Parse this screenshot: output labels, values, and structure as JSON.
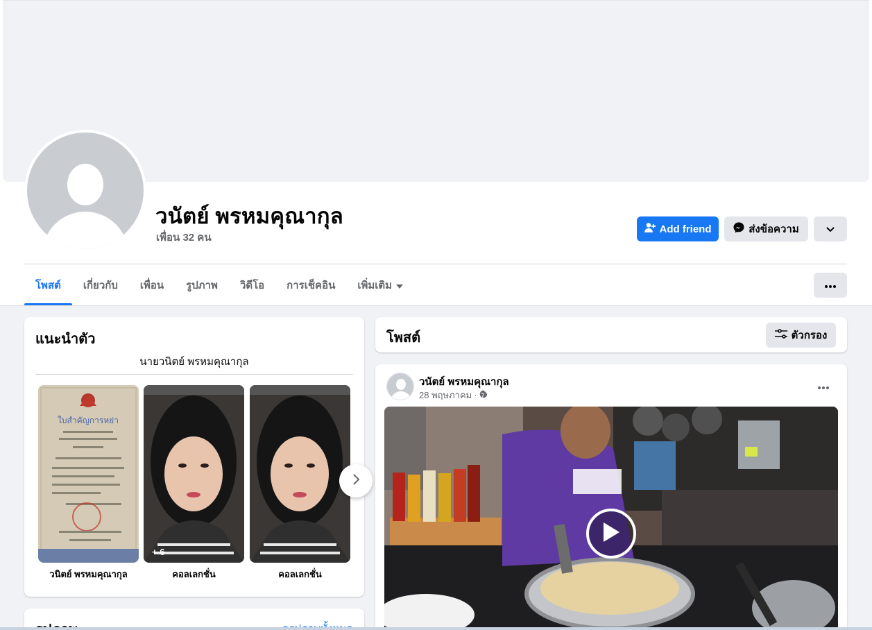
{
  "profile": {
    "name": "วนัตย์ พรหมคุณากุล",
    "friends": "เพื่อน 32 คน"
  },
  "actions": {
    "add_friend": "Add friend",
    "message": "ส่งข้อความ",
    "primary_color": "#1877f2"
  },
  "tabs": [
    {
      "label": "โพสต์",
      "active": true
    },
    {
      "label": "เกี่ยวกับ"
    },
    {
      "label": "เพื่อน"
    },
    {
      "label": "รูปภาพ"
    },
    {
      "label": "วิดีโอ"
    },
    {
      "label": "การเช็คอิน"
    },
    {
      "label": "เพิ่มเติม"
    }
  ],
  "intro": {
    "title": "แนะนำตัว",
    "bio": "นายวนิตย์ พรหมคุณากุล",
    "featured": [
      {
        "label": "วนิตย์ พรหมคุณากุล",
        "doc_title": "ใบสำคัญการหย่า"
      },
      {
        "label": "คอลเลกชั่น",
        "count": "+ 6"
      },
      {
        "label": "คอลเลกชั่น"
      }
    ]
  },
  "photos": {
    "title": "รูปภาพ",
    "see_all": "ดูรูปภาพทั้งหมด"
  },
  "posts": {
    "title": "โพสต์",
    "filter": "ตัวกรอง"
  },
  "post": {
    "author": "วนัตย์ พรหมคุณากุล",
    "date": "28 พฤษภาคม",
    "separator": "·"
  }
}
